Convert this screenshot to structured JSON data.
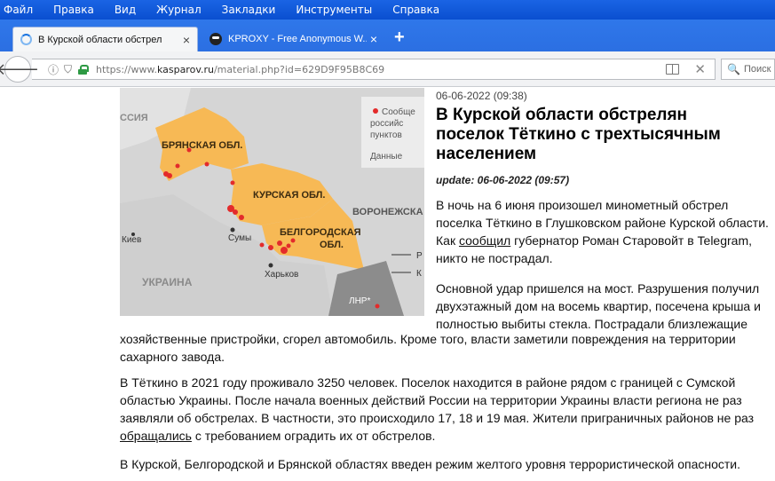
{
  "menu": [
    "Файл",
    "Правка",
    "Вид",
    "Журнал",
    "Закладки",
    "Инструменты",
    "Справка"
  ],
  "tabs": [
    {
      "title": "В Курской области обстрел",
      "close": "×"
    },
    {
      "title": "KPROXY - Free Anonymous W...",
      "close": "×"
    }
  ],
  "newtab_label": "+",
  "url": {
    "prefix": "https://www.",
    "host": "kasparov.ru",
    "path": "/material.php?id=629D9F95B8C69"
  },
  "search_placeholder": "Поиск",
  "map": {
    "labels": {
      "russia": "ССИЯ",
      "bryansk": "БРЯНСКАЯ ОБЛ.",
      "kursk": "КУРСКАЯ ОБЛ.",
      "voronezh": "ВОРОНЕЖСКА",
      "belgorod1": "БЕЛГОРОДСКАЯ",
      "belgorod2": "ОБЛ.",
      "kiev": "Киев",
      "sumy": "Сумы",
      "kharkov": "Харьков",
      "ukraine": "УКРАИНА",
      "lnr": "ЛНР*",
      "legend1": "Сообще",
      "legend2": "российс",
      "legend3": "пунктов",
      "legend4": "Данные",
      "legend_r": "Р",
      "legend_k": "К"
    },
    "colors": {
      "region": "#f7b955",
      "land": "#d9d9d9",
      "water": "#cfd8e0",
      "marker": "#e32b2b"
    }
  },
  "article": {
    "date": "06-06-2022 (09:38)",
    "title": "В Курской области обстрелян поселок Тёткино с трехтысячным населением",
    "update": "update: 06-06-2022 (09:57)",
    "p1_a": "В ночь на 6 июня произошел минометный обстрел поселка Тёткино в Глушковском районе Курской области. Как ",
    "p1_link": "сообщил",
    "p1_b": " губернатор Роман Старовойт в Telegram, никто не пострадал.",
    "p2a": "Основной удар пришелся на мост. Разрушения получил двухэтажный дом на восемь квартир, посечена крыша и полностью выбиты стекла. Пострадали близлежащие",
    "p2b": "хозяйственные пристройки, сгорел автомобиль. Кроме того, власти заметили повреждения на территории сахарного завода.",
    "p3_a": "В Тёткино в 2021 году проживало 3250 человек. Поселок находится в районе рядом с границей с Сумской областью Украины. После начала военных действий России на территории Украины власти региона не раз заявляли об обстрелах. В частности, это происходило 17, 18 и 19 мая. Жители приграничных районов не раз ",
    "p3_link": "обращались",
    "p3_b": " с требованием оградить их от обстрелов.",
    "p4": "В Курской, Белгородской и Брянской областях введен режим желтого уровня террористической опасности."
  }
}
